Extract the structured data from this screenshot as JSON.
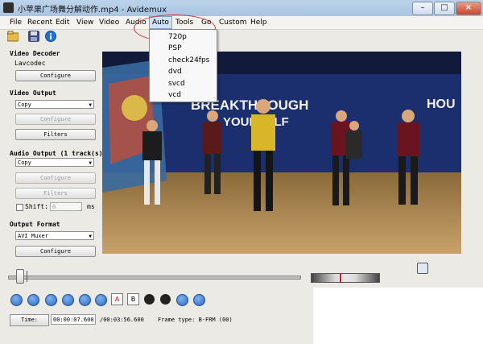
{
  "window": {
    "title": "小苹果广场舞分解动作.mp4 - Avidemux",
    "controls": [
      "–",
      "□",
      "×"
    ]
  },
  "menubar": [
    "File",
    "Recent",
    "Edit",
    "View",
    "Video",
    "Audio",
    "Auto",
    "Tools",
    "Go",
    "Custom",
    "Help"
  ],
  "auto_menu": [
    "720p",
    "PSP",
    "check24fps",
    "dvd",
    "svcd",
    "vcd"
  ],
  "left_panel": {
    "video_decoder": {
      "heading": "Video Decoder",
      "codec": "Lavcodec",
      "configure": "Configure"
    },
    "video_output": {
      "heading": "Video Output",
      "selected": "Copy",
      "configure": "Configure",
      "filters": "Filters"
    },
    "audio_output": {
      "heading": "Audio Output (1 track(s))",
      "selected": "Copy",
      "configure": "Configure",
      "filters": "Filters",
      "shift_label": "Shift:",
      "shift_value": "0",
      "shift_unit": "ms"
    },
    "output_format": {
      "heading": "Output Format",
      "selected": "AVI Muxer",
      "configure": "Configure"
    }
  },
  "playback": {
    "position": 0.033,
    "buttons": [
      "play",
      "rewind",
      "back",
      "prev-frame",
      "next-frame",
      "forward"
    ],
    "marker_a": "A",
    "marker_b": "B"
  },
  "time": {
    "button": "Time:",
    "current": "00:00:07.600",
    "total": "/00:03:56.600",
    "frame_type": "Frame type: B-FRM (00)"
  },
  "video": {
    "banner_left": "BREAKTHROUGH",
    "banner_left2": "YOURSELF",
    "banner_right": "HOU"
  }
}
